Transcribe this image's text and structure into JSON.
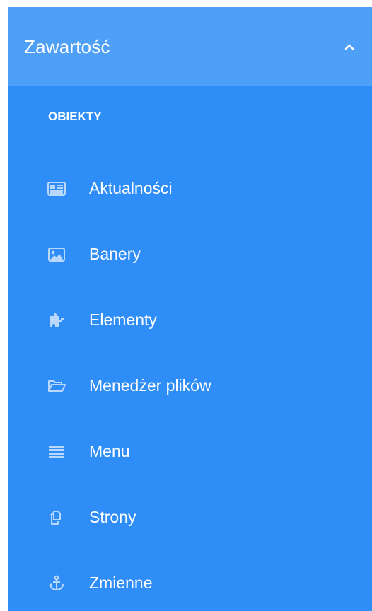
{
  "menu": {
    "title": "Zawartość",
    "section_label": "OBIEKTY",
    "items": [
      {
        "label": "Aktualności",
        "icon": "newspaper-icon"
      },
      {
        "label": "Banery",
        "icon": "image-icon"
      },
      {
        "label": "Elementy",
        "icon": "puzzle-icon"
      },
      {
        "label": "Menedżer plików",
        "icon": "folder-open-icon"
      },
      {
        "label": "Menu",
        "icon": "list-icon"
      },
      {
        "label": "Strony",
        "icon": "copy-icon"
      },
      {
        "label": "Zmienne",
        "icon": "anchor-icon"
      }
    ]
  },
  "colors": {
    "panel": "#2e8df7",
    "header": "#4d9ff8",
    "icon": "#b9d8fc",
    "text": "#ffffff"
  }
}
